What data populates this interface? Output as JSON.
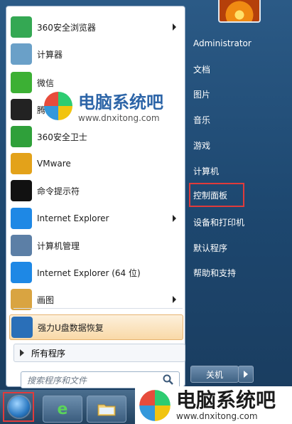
{
  "left_items": [
    {
      "label": "360安全浏览器",
      "icon": "browser-360-icon",
      "color": "#34a853",
      "sub": true
    },
    {
      "label": "计算器",
      "icon": "calculator-icon",
      "color": "#6aa0c8",
      "sub": false
    },
    {
      "label": "微信",
      "icon": "wechat-icon",
      "color": "#3cb034",
      "sub": false
    },
    {
      "label": "腾讯QQ",
      "icon": "qq-icon",
      "color": "#222222",
      "sub": false
    },
    {
      "label": "360安全卫士",
      "icon": "guard-360-icon",
      "color": "#2fa03a",
      "sub": false
    },
    {
      "label": "VMware",
      "icon": "vmware-icon",
      "color": "#e3a21a",
      "sub": false
    },
    {
      "label": "命令提示符",
      "icon": "cmd-icon",
      "color": "#111111",
      "sub": false
    },
    {
      "label": "Internet Explorer",
      "icon": "ie-icon",
      "color": "#1e88e5",
      "sub": true
    },
    {
      "label": "计算机管理",
      "icon": "computer-management-icon",
      "color": "#5c7fa6",
      "sub": false
    },
    {
      "label": "Internet Explorer (64 位)",
      "icon": "ie-icon",
      "color": "#1e88e5",
      "sub": false
    },
    {
      "label": "画图",
      "icon": "paint-icon",
      "color": "#d9a441",
      "sub": true
    },
    {
      "label": "强力U盘数据恢复",
      "icon": "usb-recovery-icon",
      "color": "#2a6fb8",
      "sub": false
    }
  ],
  "all_programs": "所有程序",
  "search_placeholder": "搜索程序和文件",
  "right_items": [
    {
      "label": "Administrator"
    },
    {
      "label": "文档"
    },
    {
      "label": "图片"
    },
    {
      "label": "音乐"
    },
    {
      "label": "游戏"
    },
    {
      "label": "计算机"
    },
    {
      "label": "控制面板"
    },
    {
      "label": "设备和打印机"
    },
    {
      "label": "默认程序"
    },
    {
      "label": "帮助和支持"
    }
  ],
  "shutdown_label": "关机",
  "watermark": {
    "title": "电脑系统吧",
    "url": "www.dnxitong.com"
  },
  "colors": {
    "highlight_border": "#e03b3b",
    "menu_bg": "#2b5a86"
  }
}
